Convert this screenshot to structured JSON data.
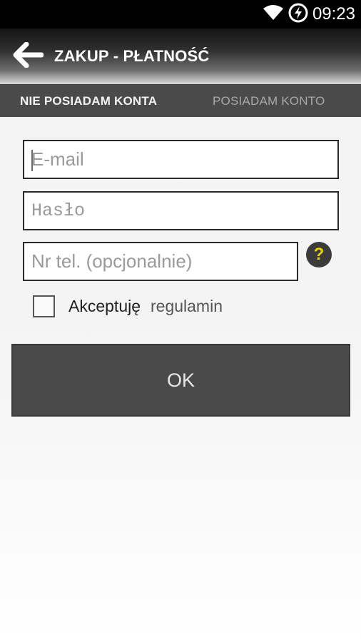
{
  "status_bar": {
    "time": "09:23",
    "icons": [
      "wifi-icon",
      "battery-charging-icon"
    ]
  },
  "action_bar": {
    "back_icon": "arrow-left-icon",
    "title": "ZAKUP - PŁATNOŚĆ"
  },
  "tabs": [
    {
      "label": "NIE POSIADAM KONTA",
      "active": true
    },
    {
      "label": "POSIADAM KONTO",
      "active": false
    }
  ],
  "form": {
    "email": {
      "placeholder": "E-mail",
      "value": ""
    },
    "password": {
      "placeholder": "Hasło",
      "value": ""
    },
    "phone": {
      "placeholder": "Nr tel. (opcjonalnie)",
      "value": ""
    },
    "help_icon": "question-mark-icon",
    "terms": {
      "label": "Akceptuję",
      "link": "regulamin",
      "checked": false
    },
    "ok_label": "OK"
  },
  "colors": {
    "accent_yellow": "#e8d500",
    "tab_bar": "#4a4a4a",
    "button": "#4a4a4a"
  }
}
